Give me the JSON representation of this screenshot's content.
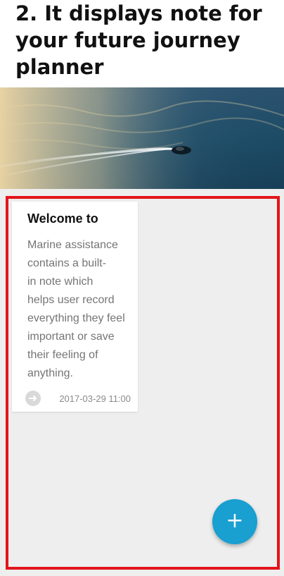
{
  "caption": {
    "text": "2. It displays note for your future journey planner"
  },
  "note": {
    "title": "Welcome to",
    "body": "Marine assistance\ncontains a built-\nin note which\nhelps user record\neverything they feel\nimportant or save\ntheir feeling of\nanything.",
    "timestamp": "2017-03-29 11:00",
    "icon": "arrow-right-icon"
  },
  "fab": {
    "label": "+",
    "icon": "add-icon"
  },
  "colors": {
    "highlight_border": "#e3141b",
    "fab_background": "#199fd0",
    "screen_background": "#eeeeee"
  }
}
